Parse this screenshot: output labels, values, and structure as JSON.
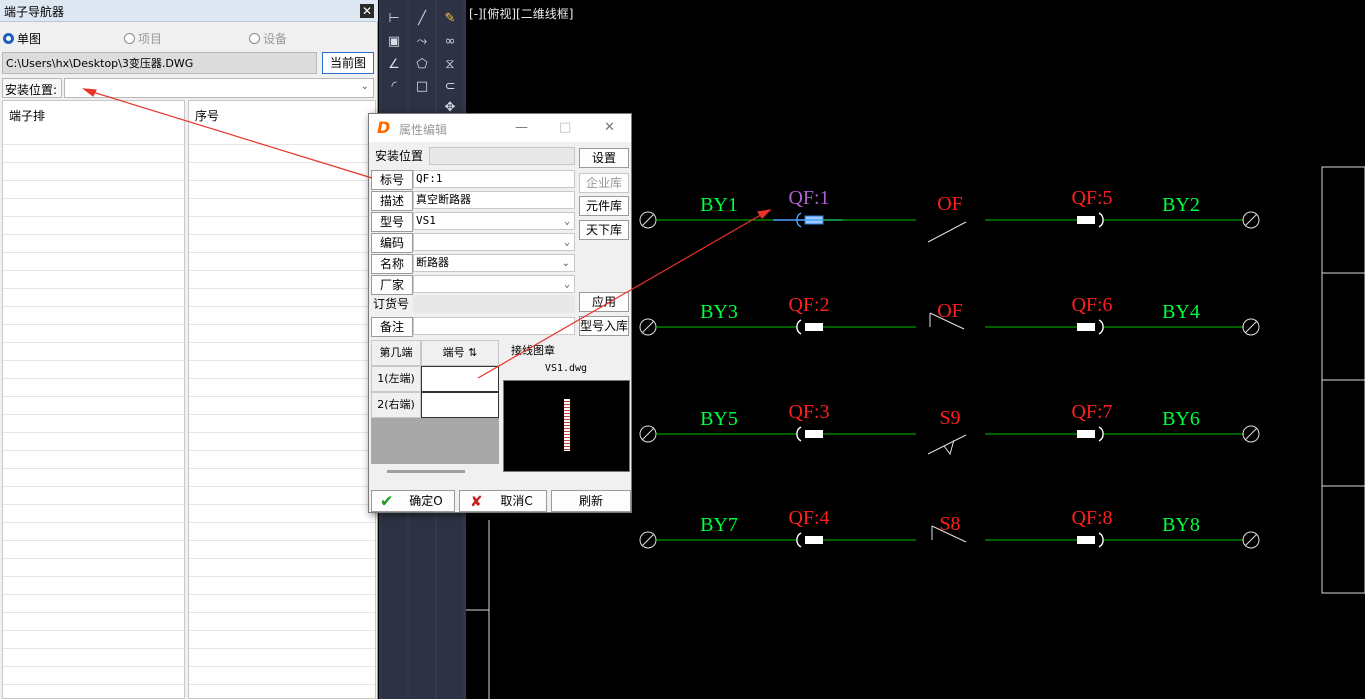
{
  "navigator": {
    "title": "端子导航器",
    "close": "✕",
    "scope_options": [
      {
        "label": "单图",
        "selected": true
      },
      {
        "label": "项目",
        "selected": false
      },
      {
        "label": "设备",
        "selected": false
      }
    ],
    "file_path": "C:\\Users\\hx\\Desktop\\3变压器.DWG",
    "current_button": "当前图",
    "location_label": "安装位置:",
    "location_value": "",
    "columns": [
      "端子排",
      "序号"
    ]
  },
  "toolbar": {
    "icons": [
      "dimension-icon",
      "line-icon",
      "brush-icon",
      "frame-icon",
      "dashed-arrow-icon",
      "link-icon",
      "angle-icon",
      "pentagon-icon",
      "mirror-icon",
      "arc-icon",
      "rectangle-icon",
      "curve-icon",
      "move-icon"
    ]
  },
  "cad": {
    "view_label": "[-][俯视][二维线框]",
    "rows": [
      {
        "left": "BY1",
        "breaker": "QF:1",
        "switch": "OF",
        "breaker2": "QF:5",
        "right": "BY2"
      },
      {
        "left": "BY3",
        "breaker": "QF:2",
        "switch": "OF",
        "breaker2": "QF:6",
        "right": "BY4"
      },
      {
        "left": "BY5",
        "breaker": "QF:3",
        "switch": "S9",
        "breaker2": "QF:7",
        "right": "BY6"
      },
      {
        "left": "BY7",
        "breaker": "QF:4",
        "switch": "S8",
        "breaker2": "QF:8",
        "right": "BY8"
      }
    ],
    "colors": {
      "wire": "#00c000",
      "label_green": "#00ff3c",
      "label_red": "#ff1e1e",
      "selected": "#b060d0",
      "arrow": "#e8332a"
    }
  },
  "dialog": {
    "title": "属性编辑",
    "logo": "D",
    "fields": {
      "location": {
        "label": "安装位置",
        "value": ""
      },
      "tag": {
        "label": "标号",
        "value": "QF:1"
      },
      "desc": {
        "label": "描述",
        "value": "真空断路器"
      },
      "model": {
        "label": "型号",
        "value": "VS1"
      },
      "code": {
        "label": "编码",
        "value": ""
      },
      "name": {
        "label": "名称",
        "value": "断路器"
      },
      "maker": {
        "label": "厂家",
        "value": ""
      },
      "order": {
        "label": "订货号",
        "value": ""
      },
      "note": {
        "label": "备注",
        "value": ""
      }
    },
    "right_buttons": {
      "settings": "设置",
      "enterprise_lib": "企业库",
      "component_lib": "元件库",
      "tianxia_lib": "天下库",
      "apply": "应用",
      "model_to_lib": "型号入库"
    },
    "table": {
      "headers": [
        "第几端",
        "端号 ⇅"
      ],
      "rows": [
        "1(左端)",
        "2(右端)"
      ]
    },
    "wiring": {
      "title": "接线图章",
      "file": "VS1.dwg"
    },
    "buttons": {
      "ok": "确定O",
      "cancel": "取消C",
      "refresh": "刷新"
    }
  }
}
